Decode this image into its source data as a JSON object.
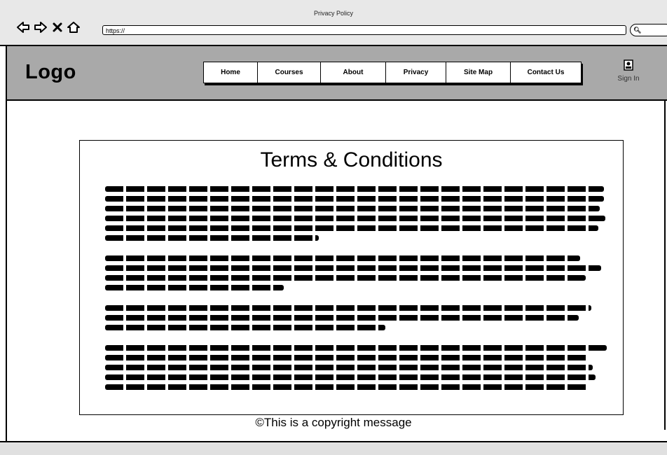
{
  "window": {
    "title": "Privacy Policy"
  },
  "browser": {
    "url": "https://"
  },
  "header": {
    "logo": "Logo",
    "nav": [
      "Home",
      "Courses",
      "About",
      "Privacy",
      "Site Map",
      "Contact Us"
    ],
    "sign_in": "Sign In"
  },
  "main": {
    "heading": "Terms & Conditions"
  },
  "footer": {
    "copyright": "©This is a copyright message"
  }
}
